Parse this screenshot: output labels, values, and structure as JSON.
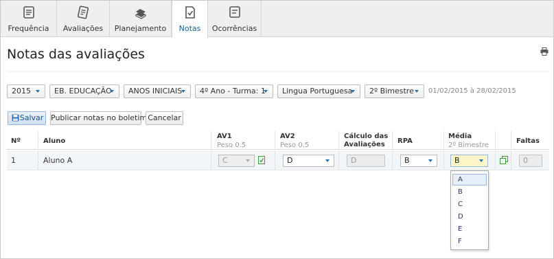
{
  "nav": {
    "tabs": [
      {
        "label": "Frequência",
        "icon": "attendance-icon"
      },
      {
        "label": "Avaliações",
        "icon": "notepad-icon"
      },
      {
        "label": "Planejamento",
        "icon": "books-icon"
      },
      {
        "label": "Notas",
        "icon": "grades-check-icon",
        "active": true
      },
      {
        "label": "Ocorrências",
        "icon": "occurrence-note-icon"
      }
    ]
  },
  "page": {
    "title": "Notas das avaliações",
    "print_icon": "printer-icon"
  },
  "filters": {
    "year": "2015",
    "segment": "EB. EDUCAÇÃO",
    "level": "ANOS INICIAIS",
    "class": "4º Ano - Turma: 1",
    "subject": "Lingua Portuguesa",
    "term": "2º Bimestre",
    "date_range": "01/02/2015 à 28/02/2015"
  },
  "actions": {
    "save": "Salvar",
    "publish": "Publicar notas no boletim",
    "cancel": "Cancelar"
  },
  "table": {
    "headers": {
      "num": "Nº",
      "student": "Aluno",
      "av1": "AV1",
      "av1_weight": "Peso 0.5",
      "av2": "AV2",
      "av2_weight": "Peso 0.5",
      "calc_line1": "Cálculo das",
      "calc_line2": "Avaliações",
      "rpa": "RPA",
      "media": "Média",
      "media_sub": "2º Bimestre",
      "faltas": "Faltas"
    },
    "rows": [
      {
        "num": "1",
        "student": "Aluno A",
        "av1": "C",
        "av2": "D",
        "calc": "D",
        "rpa": "B",
        "media": "B",
        "faltas": "0"
      }
    ]
  },
  "media_dropdown": {
    "options": [
      "A",
      "B",
      "C",
      "D",
      "E",
      "F"
    ],
    "highlighted": "A"
  },
  "colors": {
    "accent": "#2a6fb0",
    "active_tab_text": "#1a5d91",
    "row_bg": "#f3f6f9",
    "media_highlight": "#fdf6c6"
  }
}
